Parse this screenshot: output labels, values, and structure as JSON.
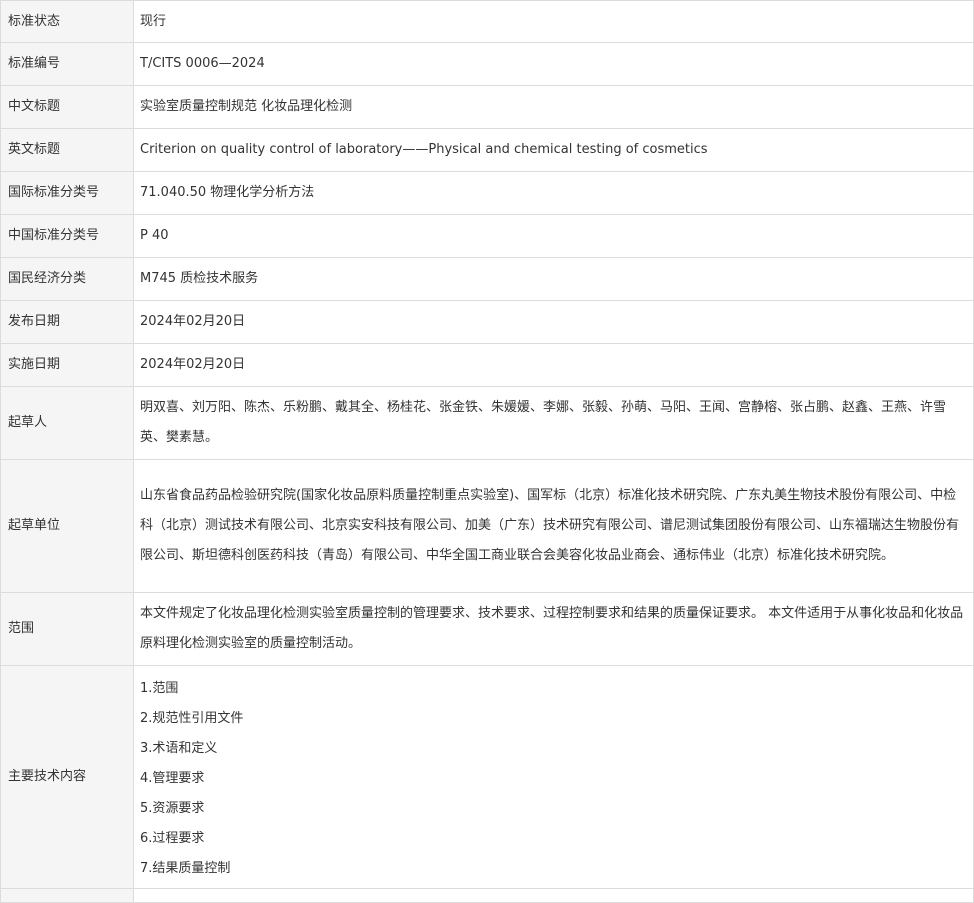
{
  "rows": [
    {
      "label": "标准状态",
      "value": "现行"
    },
    {
      "label": "标准编号",
      "value": "T/CITS 0006—2024"
    },
    {
      "label": "中文标题",
      "value": "实验室质量控制规范 化妆品理化检测"
    },
    {
      "label": "英文标题",
      "value": "Criterion on quality control of laboratory——Physical and chemical testing of cosmetics"
    },
    {
      "label": "国际标准分类号",
      "value": "71.040.50 物理化学分析方法"
    },
    {
      "label": "中国标准分类号",
      "value": "P 40"
    },
    {
      "label": "国民经济分类",
      "value": "M745 质检技术服务"
    },
    {
      "label": "发布日期",
      "value": "2024年02月20日"
    },
    {
      "label": "实施日期",
      "value": "2024年02月20日"
    },
    {
      "label": "起草人",
      "value": "明双喜、刘万阳、陈杰、乐粉鹏、戴其全、杨桂花、张金铁、朱媛媛、李娜、张毅、孙萌、马阳、王闻、宫静榕、张占鹏、赵鑫、王燕、许雪英、樊素慧。"
    },
    {
      "label": "起草单位",
      "value": "山东省食品药品检验研究院(国家化妆品原料质量控制重点实验室)、国军标（北京）标准化技术研究院、广东丸美生物技术股份有限公司、中检科（北京）测试技术有限公司、北京实安科技有限公司、加美（广东）技术研究有限公司、谱尼测试集团股份有限公司、山东福瑞达生物股份有限公司、斯坦德科创医药科技（青岛）有限公司、中华全国工商业联合会美容化妆品业商会、通标伟业（北京）标准化技术研究院。"
    },
    {
      "label": "范围",
      "value": "本文件规定了化妆品理化检测实验室质量控制的管理要求、技术要求、过程控制要求和结果的质量保证要求。 本文件适用于从事化妆品和化妆品原料理化检测实验室的质量控制活动。"
    }
  ],
  "main_content": {
    "label": "主要技术内容",
    "items": [
      "1.范围",
      "2.规范性引用文件",
      "3.术语和定义",
      "4.管理要求",
      "5.资源要求",
      "6.过程要求",
      "7.结果质量控制"
    ]
  }
}
